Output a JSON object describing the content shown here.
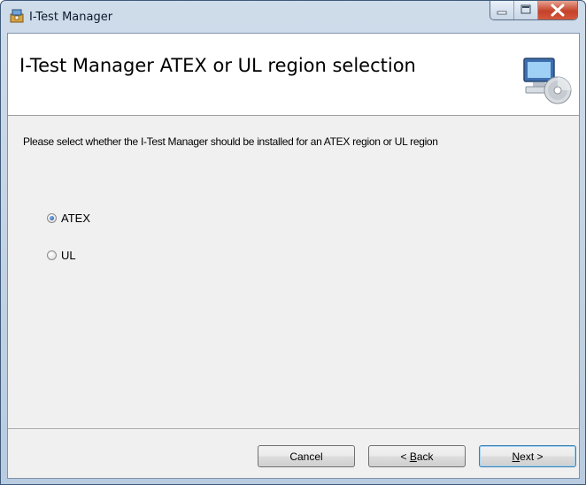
{
  "window": {
    "title": "I-Test Manager"
  },
  "banner": {
    "title": "I-Test Manager ATEX or UL region selection"
  },
  "content": {
    "description": "Please select whether the I-Test Manager should be installed for an ATEX region or UL region",
    "options": [
      {
        "label": "ATEX",
        "selected": true
      },
      {
        "label": "UL",
        "selected": false
      }
    ]
  },
  "buttons": {
    "cancel": "Cancel",
    "back_prefix": "< ",
    "back_mnemonic": "B",
    "back_rest": "ack",
    "next_mnemonic": "N",
    "next_rest": "ext >"
  }
}
